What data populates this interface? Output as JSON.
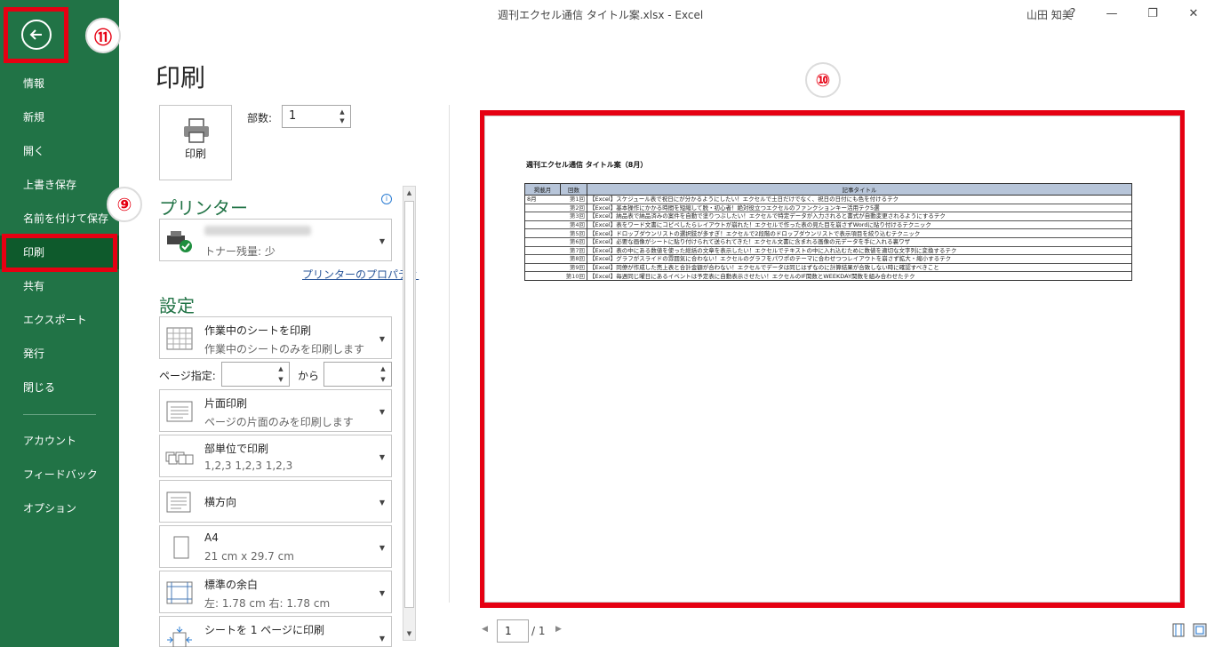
{
  "window": {
    "title": "週刊エクセル通信 タイトル案.xlsx  -  Excel",
    "user": "山田 知美",
    "help": "?",
    "minimize": "—",
    "restore": "❐",
    "close": "✕"
  },
  "sidebar": {
    "items": [
      {
        "label": "情報"
      },
      {
        "label": "新規"
      },
      {
        "label": "開く"
      },
      {
        "label": "上書き保存"
      },
      {
        "label": "名前を付けて保存"
      },
      {
        "label": "印刷"
      },
      {
        "label": "共有"
      },
      {
        "label": "エクスポート"
      },
      {
        "label": "発行"
      },
      {
        "label": "閉じる"
      },
      {
        "label": "アカウント"
      },
      {
        "label": "フィードバック"
      },
      {
        "label": "オプション"
      }
    ],
    "active": "印刷"
  },
  "annotations": {
    "back": "⑪",
    "print_menu": "⑨",
    "preview": "⑩"
  },
  "print": {
    "title": "印刷",
    "button_label": "印刷",
    "copies_label": "部数:",
    "copies_value": "1"
  },
  "printer": {
    "heading": "プリンター",
    "status": "トナー残量: 少",
    "properties_link": "プリンターのプロパティ"
  },
  "settings": {
    "heading": "設定",
    "scope": {
      "main": "作業中のシートを印刷",
      "sub": "作業中のシートのみを印刷します"
    },
    "pages_label": "ページ指定:",
    "pages_to": "から",
    "sides": {
      "main": "片面印刷",
      "sub": "ページの片面のみを印刷します"
    },
    "collate": {
      "main": "部単位で印刷",
      "sub": "1,2,3    1,2,3    1,2,3"
    },
    "orientation": {
      "main": "横方向"
    },
    "paper": {
      "main": "A4",
      "sub": "21 cm x 29.7 cm"
    },
    "margins": {
      "main": "標準の余白",
      "sub": "左:  1.78 cm     右:  1.78 cm"
    },
    "scaling": {
      "main": "シートを 1 ページに印刷"
    }
  },
  "preview": {
    "sheet_title": "週刊エクセル通信 タイトル案（8月）",
    "headers": [
      "掲載月",
      "回数",
      "記事タイトル"
    ],
    "rows": [
      {
        "month": "8月",
        "no": "第1回",
        "title": "【Excel】スケジュール表で祝日にが分かるようにしたい！エクセルで土日だけでなく、祝日の日付にも色を付けるテク"
      },
      {
        "month": "",
        "no": "第2回",
        "title": "【Excel】基本操作にかかる時間を短縮して脱・初心者！絶対役立つエクセルのファンクションキー活用テク5選"
      },
      {
        "month": "",
        "no": "第3回",
        "title": "【Excel】納品表で納品済みの案件を自動で塗りつぶしたい！エクセルで特定データが入力されると書式が自動変更されるようにするテク"
      },
      {
        "month": "",
        "no": "第4回",
        "title": "【Excel】表をワード文書にコピペしたらレイアウトが崩れた！エクセルで作った表の見た目を崩さずWordに貼り付けるテクニック"
      },
      {
        "month": "",
        "no": "第5回",
        "title": "【Excel】ドロップダウンリストの選択肢が多すぎ！エクセルで2段階のドロップダウンリストで表示項目を絞り込むテクニック"
      },
      {
        "month": "",
        "no": "第6回",
        "title": "【Excel】必要な画像がシートに貼り付けられて送られてきた！エクセル文書に含まれる画像の元データを手に入れる裏ワザ"
      },
      {
        "month": "",
        "no": "第7回",
        "title": "【Excel】表の中にある数値を使った総括の文章を表示したい！エクセルでテキストの中に入れ込むために数値を適切な文字列に変換するテク"
      },
      {
        "month": "",
        "no": "第8回",
        "title": "【Excel】グラフがスライドの雰囲気に合わない！エクセルのグラフをパワポのテーマに合わせつつレイアウトを崩さず拡大・縮小するテク"
      },
      {
        "month": "",
        "no": "第9回",
        "title": "【Excel】同僚が作成した売上表と合計金額が合わない！エクセルでデータは同じはずなのに計算結果が合致しない時に確認すべきこと"
      },
      {
        "month": "",
        "no": "第10回",
        "title": "【Excel】毎週同じ曜日にあるイベントは予定表に自動表示させたい！エクセルのIF関数とWEEKDAY関数を組み合わせたテク"
      }
    ]
  },
  "pagination": {
    "current": "1",
    "total": "/ 1"
  }
}
